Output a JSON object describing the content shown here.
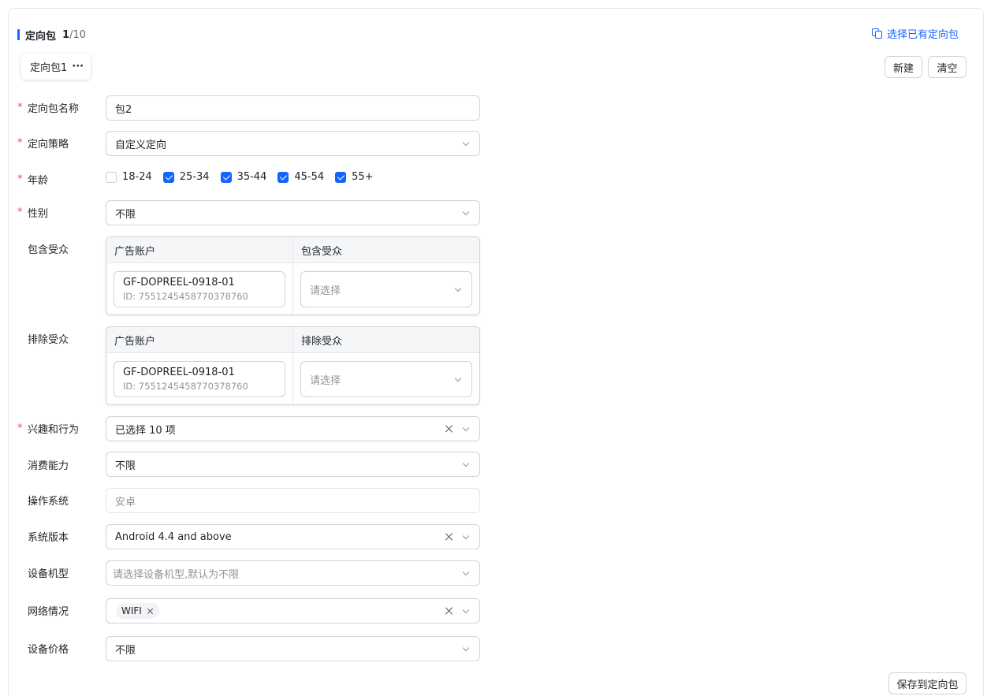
{
  "header": {
    "title": "定向包",
    "current": "1",
    "total": "/10",
    "select_existing": "选择已有定向包"
  },
  "tab": {
    "label": "定向包1",
    "more": "···"
  },
  "buttons": {
    "new": "新建",
    "clear": "清空",
    "save": "保存到定向包"
  },
  "form": {
    "name": {
      "label": "定向包名称",
      "value": "包2"
    },
    "strategy": {
      "label": "定向策略",
      "value": "自定义定向"
    },
    "age": {
      "label": "年龄",
      "options": [
        {
          "label": "18-24",
          "checked": false
        },
        {
          "label": "25-34",
          "checked": true
        },
        {
          "label": "35-44",
          "checked": true
        },
        {
          "label": "45-54",
          "checked": true
        },
        {
          "label": "55+",
          "checked": true
        }
      ]
    },
    "gender": {
      "label": "性别",
      "value": "不限"
    },
    "include_audience": {
      "label": "包含受众",
      "col1": "广告账户",
      "col2": "包含受众",
      "account_name": "GF-DOPREEL-0918-01",
      "account_id": "ID: 7551245458770378760",
      "placeholder": "请选择"
    },
    "exclude_audience": {
      "label": "排除受众",
      "col1": "广告账户",
      "col2": "排除受众",
      "account_name": "GF-DOPREEL-0918-01",
      "account_id": "ID: 7551245458770378760",
      "placeholder": "请选择"
    },
    "interest": {
      "label": "兴趣和行为",
      "value": "已选择 10 项"
    },
    "spending": {
      "label": "消费能力",
      "value": "不限"
    },
    "os": {
      "label": "操作系统",
      "value": "安卓"
    },
    "os_version": {
      "label": "系统版本",
      "value": "Android 4.4 and above"
    },
    "device_model": {
      "label": "设备机型",
      "placeholder": "请选择设备机型,默认为不限"
    },
    "network": {
      "label": "网络情况",
      "tags": [
        "WIFI"
      ]
    },
    "device_price": {
      "label": "设备价格",
      "value": "不限"
    }
  },
  "colors": {
    "accent": "#1664ff",
    "required": "#f54a45",
    "border": "#d0d3d6"
  }
}
